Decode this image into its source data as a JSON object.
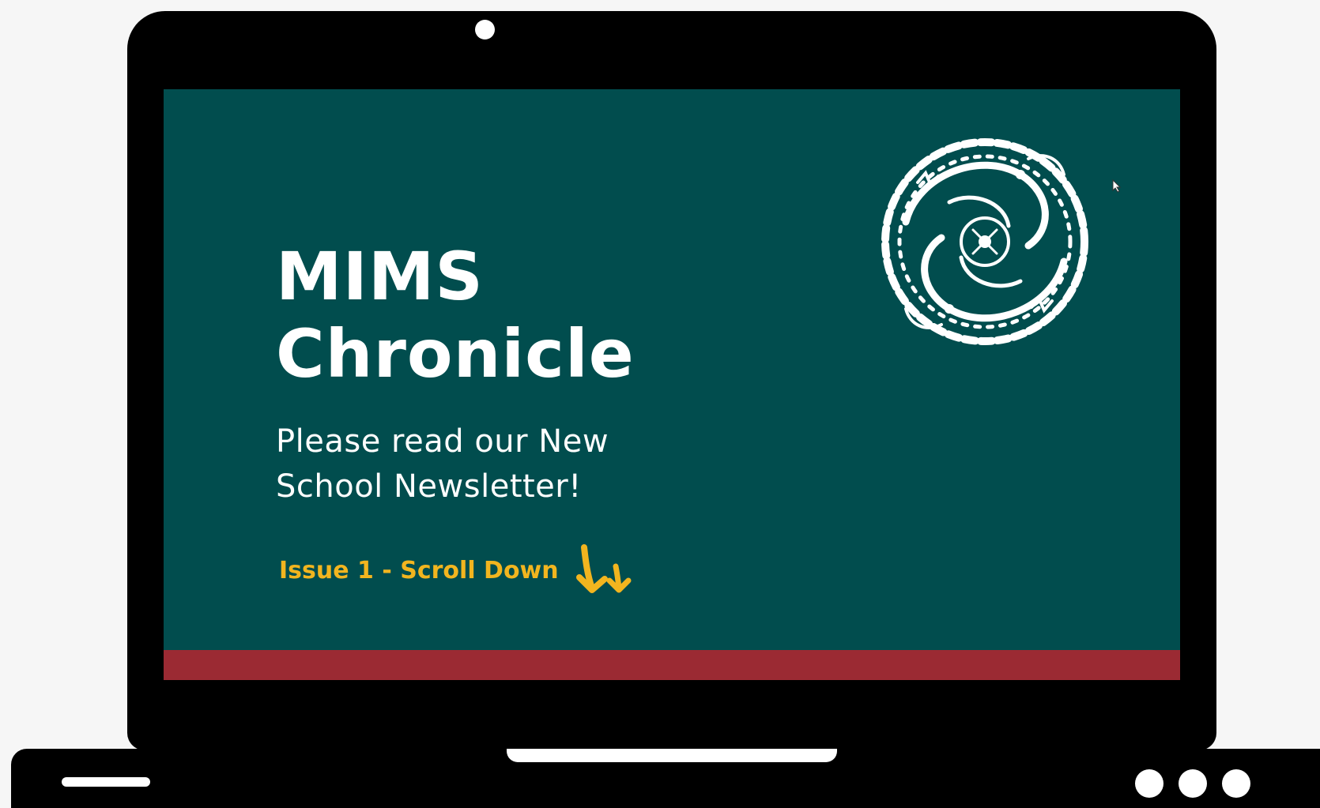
{
  "slide": {
    "title_line1": "MIMS",
    "title_line2": "Chronicle",
    "subtitle_line1": "Please read our New",
    "subtitle_line2": "School Newsletter!",
    "issue_label": "Issue 1 - Scroll Down"
  },
  "icons": {
    "emblem": "dragon-emblem-icon",
    "arrows": "double-down-arrow-icon",
    "cursor": "mouse-pointer-icon"
  },
  "colors": {
    "screen_background": "#014d4e",
    "accent_yellow": "#f2b51f",
    "bottom_band": "#9b2a33",
    "device": "#000000",
    "page_background": "#f6f6f6"
  }
}
